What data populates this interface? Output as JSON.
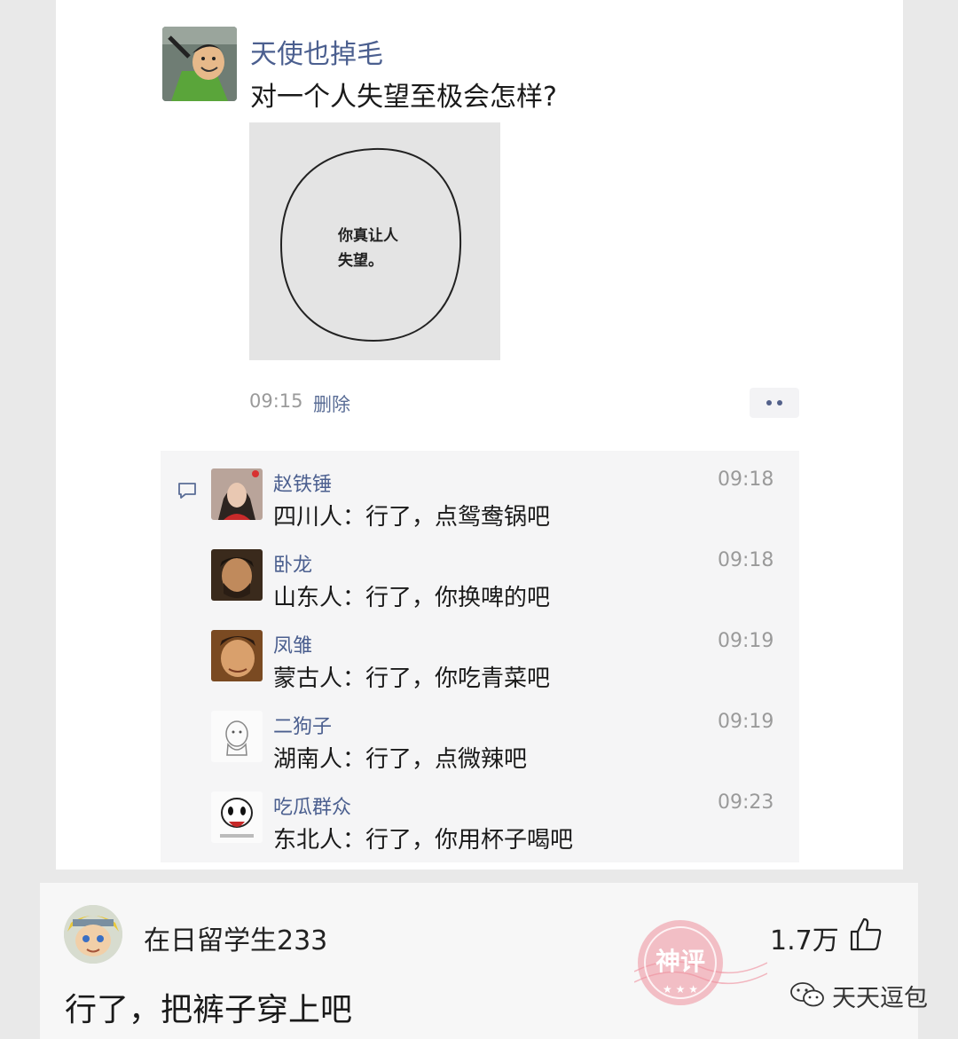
{
  "post": {
    "author": "天使也掉毛",
    "text": "对一个人失望至极会怎样?",
    "image_text_line1": "你真让人",
    "image_text_line2": "失望。",
    "time": "09:15",
    "delete_label": "删除"
  },
  "comments": [
    {
      "name": "赵铁锤",
      "text": "四川人：行了，点鸳鸯锅吧",
      "time": "09:18"
    },
    {
      "name": "卧龙",
      "text": "山东人：行了，你换啤的吧",
      "time": "09:18"
    },
    {
      "name": "凤雏",
      "text": "蒙古人：行了，你吃青菜吧",
      "time": "09:19"
    },
    {
      "name": "二狗子",
      "text": "湖南人：行了，点微辣吧",
      "time": "09:19"
    },
    {
      "name": "吃瓜群众",
      "text": "东北人：行了，你用杯子喝吧",
      "time": "09:23"
    }
  ],
  "reply": {
    "username": "在日留学生233",
    "likes": "1.7万",
    "text": "行了，把裤子穿上吧",
    "stamp_label": "神评",
    "watermark": "天天逗包"
  },
  "colors": {
    "name_blue": "#4b5f8f",
    "stamp_red": "#e86a7a"
  }
}
